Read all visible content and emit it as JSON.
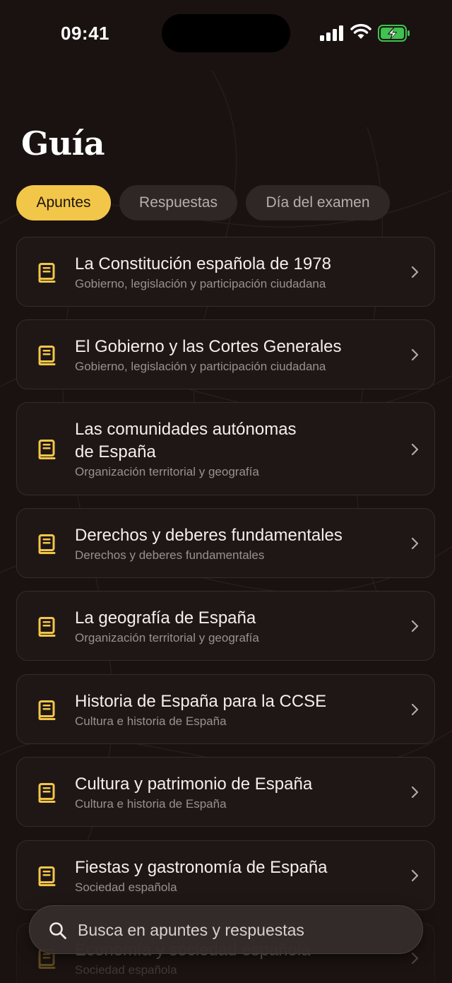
{
  "status_bar": {
    "time": "09:41"
  },
  "page": {
    "title": "Guía"
  },
  "tabs": [
    {
      "label": "Apuntes",
      "active": true
    },
    {
      "label": "Respuestas",
      "active": false
    },
    {
      "label": "Día del examen",
      "active": false
    }
  ],
  "notes": [
    {
      "title": "La Constitución española de 1978",
      "subtitle": "Gobierno, legislación y participación ciudadana"
    },
    {
      "title": "El Gobierno y las Cortes Generales",
      "subtitle": "Gobierno, legislación y participación ciudadana"
    },
    {
      "title_line1": "Las comunidades autónomas",
      "title_line2": "de España",
      "subtitle": "Organización territorial y geografía"
    },
    {
      "title": "Derechos y deberes fundamentales",
      "subtitle": "Derechos y deberes fundamentales"
    },
    {
      "title": "La geografía de España",
      "subtitle": "Organización territorial y geografía"
    },
    {
      "title": "Historia de España para la CCSE",
      "subtitle": "Cultura e historia de España"
    },
    {
      "title": "Cultura y patrimonio de España",
      "subtitle": "Cultura e historia de España"
    },
    {
      "title": "Fiestas y gastronomía de España",
      "subtitle": "Sociedad española"
    },
    {
      "title": "Economía y sociedad española",
      "subtitle": "Sociedad española"
    }
  ],
  "search": {
    "placeholder": "Busca en apuntes y respuestas",
    "value": ""
  },
  "colors": {
    "background": "#1a1211",
    "accent": "#f2c648",
    "card": "#1f1716",
    "icon": "#f2c648"
  },
  "icons": {
    "note": "book-icon",
    "chevron": "chevron-right-icon",
    "search": "search-icon"
  }
}
